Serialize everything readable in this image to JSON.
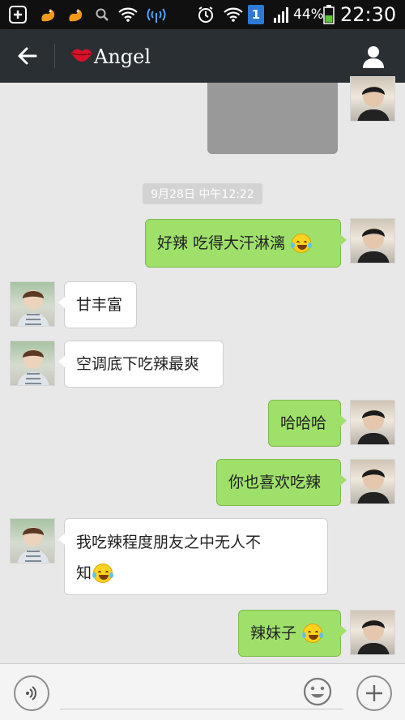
{
  "status_bar": {
    "time": "22:30",
    "battery": "44%",
    "sim_badge": "1",
    "icons": [
      "add-icon",
      "squirrel-icon",
      "squirrel-icon",
      "search-icon",
      "wifi-icon",
      "signal-broadcast-icon",
      "alarm-icon",
      "wifi-icon",
      "signal-bars-icon",
      "battery-icon"
    ]
  },
  "header": {
    "title": "Angel",
    "back_icon": "back-arrow-icon",
    "profile_icon": "person-icon",
    "title_icon": "lips-icon"
  },
  "chat": {
    "timestamp": "9月28日 中午12:22",
    "messages": [
      {
        "sender": "me",
        "type": "image"
      },
      {
        "sender": "me",
        "text": "好辣 吃得大汗淋漓",
        "emoji": "laugh-cry-emoji"
      },
      {
        "sender": "her",
        "text": "甘丰富"
      },
      {
        "sender": "her",
        "text": "空调底下吃辣最爽"
      },
      {
        "sender": "me",
        "text": "哈哈哈"
      },
      {
        "sender": "me",
        "text": "你也喜欢吃辣"
      },
      {
        "sender": "her",
        "line1": "我吃辣程度朋友之中无人不",
        "line2": "知",
        "emoji": "laugh-cry-emoji"
      },
      {
        "sender": "me",
        "text": "辣妹子",
        "emoji": "laugh-cry-emoji"
      }
    ]
  },
  "input_bar": {
    "voice_icon": "voice-icon",
    "emoji_icon": "smiley-icon",
    "plus_icon": "plus-icon",
    "placeholder": ""
  },
  "colors": {
    "header_bg": "#2a2f33",
    "my_bubble": "#9fe06b",
    "her_bubble": "#ffffff",
    "chat_bg": "#e8e8e8"
  }
}
